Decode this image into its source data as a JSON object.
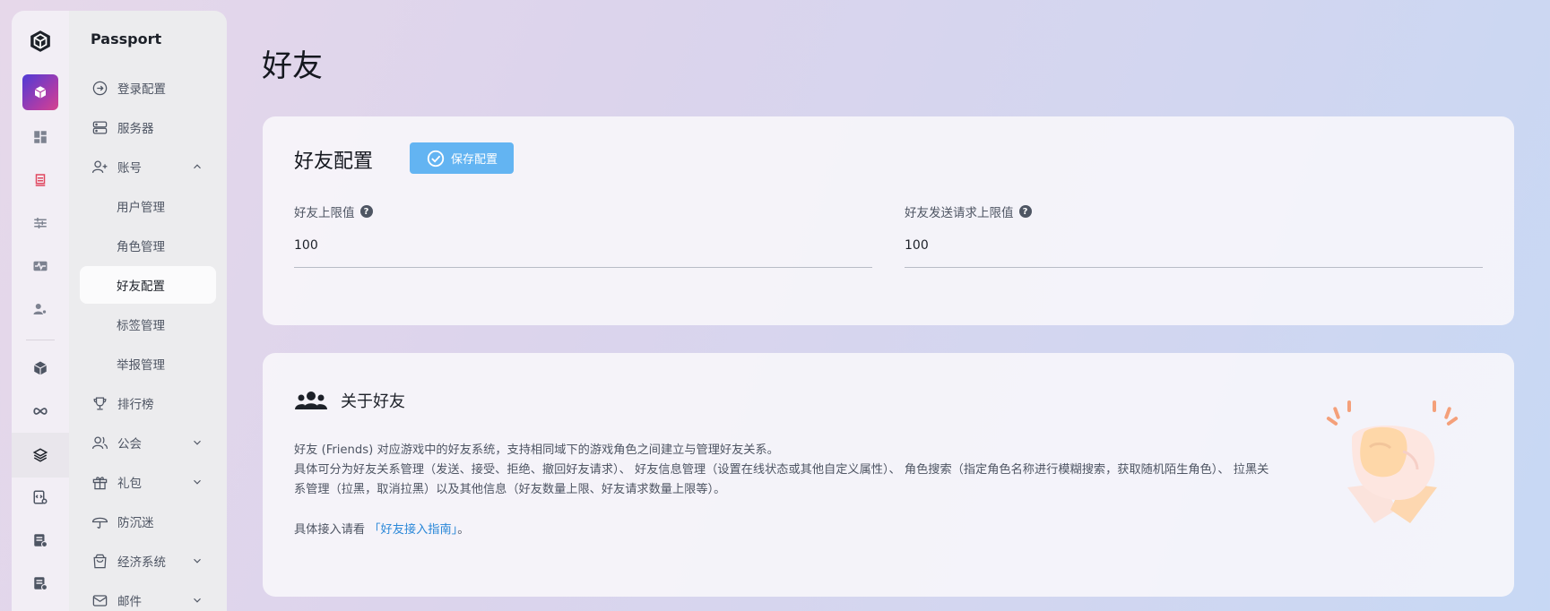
{
  "sidebar": {
    "title": "Passport",
    "items": [
      {
        "label": "登录配置",
        "icon": "arrow-circle-right-icon"
      },
      {
        "label": "服务器",
        "icon": "server-icon"
      },
      {
        "label": "账号",
        "icon": "user-add-icon",
        "expanded": true
      },
      {
        "label": "用户管理"
      },
      {
        "label": "角色管理"
      },
      {
        "label": "好友配置",
        "selected": true
      },
      {
        "label": "标签管理"
      },
      {
        "label": "举报管理"
      },
      {
        "label": "排行榜",
        "icon": "trophy-icon"
      },
      {
        "label": "公会",
        "icon": "users-icon"
      },
      {
        "label": "礼包",
        "icon": "gift-icon"
      },
      {
        "label": "防沉迷",
        "icon": "umbrella-icon"
      },
      {
        "label": "经济系统",
        "icon": "shopping-bag-icon"
      },
      {
        "label": "邮件",
        "icon": "mail-icon"
      }
    ]
  },
  "page": {
    "title": "好友"
  },
  "config": {
    "title": "好友配置",
    "save_label": "保存配置",
    "fields": [
      {
        "label": "好友上限值",
        "value": "100"
      },
      {
        "label": "好友发送请求上限值",
        "value": "100"
      }
    ]
  },
  "about": {
    "title": "关于好友",
    "line1": "好友 (Friends) 对应游戏中的好友系统，支持相同域下的游戏角色之间建立与管理好友关系。",
    "line2": "具体可分为好友关系管理（发送、接受、拒绝、撤回好友请求）、 好友信息管理（设置在线状态或其他自定义属性）、 角色搜索（指定角色名称进行模糊搜索，获取随机陌生角色）、 拉黑关系管理（拉黑，取消拉黑）以及其他信息（好友数量上限、好友请求数量上限等）。",
    "link_prefix": "具体接入请看",
    "link_text": "「好友接入指南」",
    "link_suffix": "。"
  },
  "colors": {
    "accent": "#63b4f2",
    "link": "#2b88d8"
  }
}
